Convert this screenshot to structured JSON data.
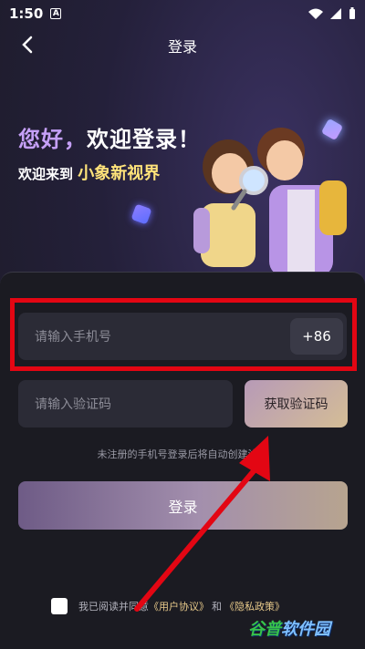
{
  "status_bar": {
    "time": "1:50",
    "notif_letter": "A"
  },
  "nav": {
    "title": "登录"
  },
  "hero": {
    "greeting_prefix": "您好，",
    "greeting_suffix": "欢迎登录！",
    "welcome_text": "欢迎来到",
    "brand": "小象新视界"
  },
  "form": {
    "phone_placeholder": "请输入手机号",
    "country_code": "+86",
    "code_placeholder": "请输入验证码",
    "get_code_label": "获取验证码",
    "hint": "未注册的手机号登录后将自动创建注册",
    "login_label": "登录"
  },
  "agreement": {
    "prefix": "我已阅读并同意",
    "user_agreement": "《用户协议》",
    "and": "和",
    "privacy_policy": "《隐私政策》"
  },
  "watermark": {
    "text_a": "谷普",
    "text_b": "软件园"
  },
  "colors": {
    "annotation": "#e30613",
    "accent_purple": "#c5a0f7",
    "brand_yellow": "#ffe37a"
  }
}
